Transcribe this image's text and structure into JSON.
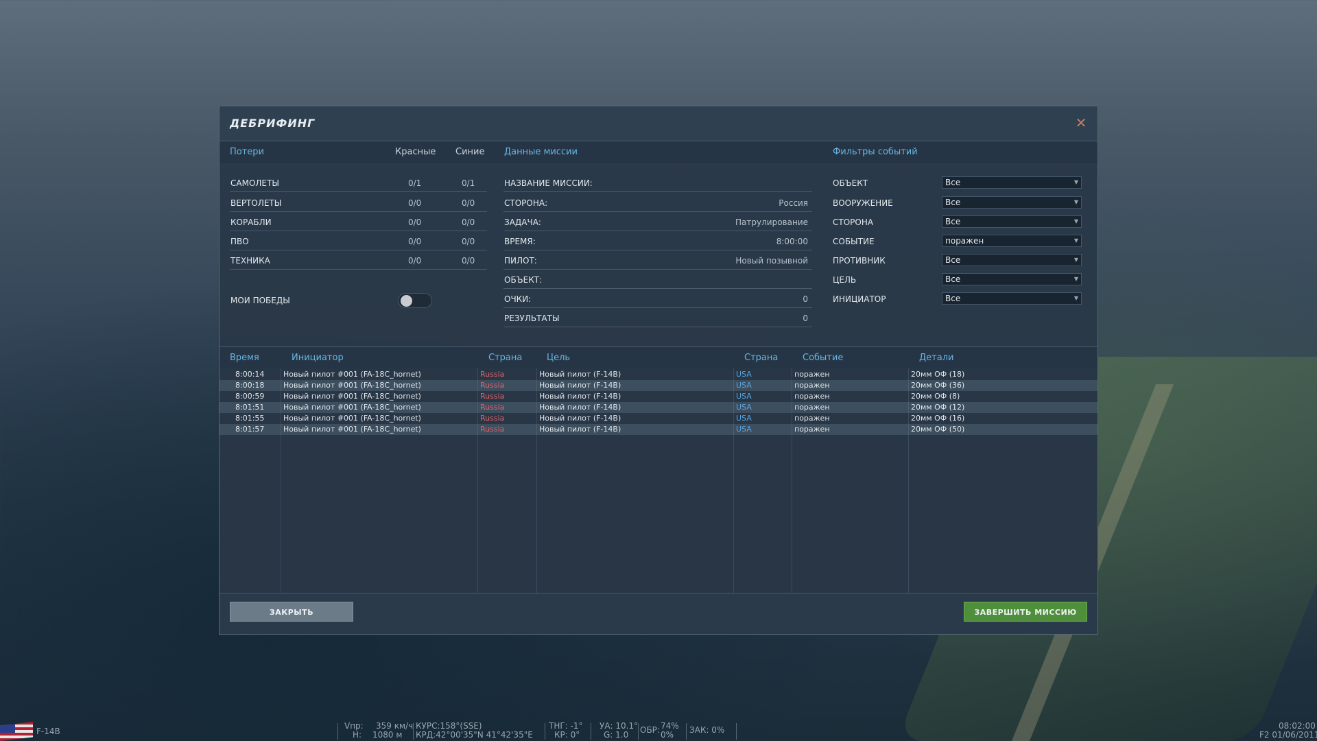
{
  "dialog": {
    "title": "ДЕБРИФИНГ",
    "close_glyph": "✕"
  },
  "losses": {
    "header": "Потери",
    "col_red": "Красные",
    "col_blue": "Синие",
    "rows": [
      {
        "label": "САМОЛЕТЫ",
        "red": "0/1",
        "blue": "0/1"
      },
      {
        "label": "ВЕРТОЛЕТЫ",
        "red": "0/0",
        "blue": "0/0"
      },
      {
        "label": "КОРАБЛИ",
        "red": "0/0",
        "blue": "0/0"
      },
      {
        "label": "ПВО",
        "red": "0/0",
        "blue": "0/0"
      },
      {
        "label": "ТЕХНИКА",
        "red": "0/0",
        "blue": "0/0"
      }
    ],
    "my_wins_label": "МОИ ПОБЕДЫ",
    "my_wins_on": false
  },
  "mission": {
    "header": "Данные миссии",
    "rows": [
      {
        "label": "НАЗВАНИЕ МИССИИ:",
        "value": ""
      },
      {
        "label": "СТОРОНА:",
        "value": "Россия"
      },
      {
        "label": "ЗАДАЧА:",
        "value": "Патрулирование"
      },
      {
        "label": "ВРЕМЯ:",
        "value": "8:00:00"
      },
      {
        "label": "ПИЛОТ:",
        "value": "Новый позывной"
      },
      {
        "label": "ОБЪЕКТ:",
        "value": ""
      },
      {
        "label": "ОЧКИ:",
        "value": "0"
      },
      {
        "label": "РЕЗУЛЬТАТЫ",
        "value": "0"
      }
    ]
  },
  "filters": {
    "header": "Фильтры событий",
    "rows": [
      {
        "label": "ОБЪЕКТ",
        "value": "Все"
      },
      {
        "label": "ВООРУЖЕНИЕ",
        "value": "Все"
      },
      {
        "label": "СТОРОНА",
        "value": "Все"
      },
      {
        "label": "СОБЫТИЕ",
        "value": "поражен"
      },
      {
        "label": "ПРОТИВНИК",
        "value": "Все"
      },
      {
        "label": "ЦЕЛЬ",
        "value": "Все"
      },
      {
        "label": "ИНИЦИАТОР",
        "value": "Все"
      }
    ]
  },
  "log": {
    "columns": [
      "Время",
      "Инициатор",
      "Страна",
      "Цель",
      "Страна",
      "Событие",
      "Детали"
    ],
    "rows": [
      {
        "time": "8:00:14",
        "initiator": "Новый пилот #001 (FA-18C_hornet)",
        "init_country": "Russia",
        "target": "Новый пилот (F-14B)",
        "target_country": "USA",
        "event": "поражен",
        "details": "20мм ОФ (18)"
      },
      {
        "time": "8:00:18",
        "initiator": "Новый пилот #001 (FA-18C_hornet)",
        "init_country": "Russia",
        "target": "Новый пилот (F-14B)",
        "target_country": "USA",
        "event": "поражен",
        "details": "20мм ОФ (36)"
      },
      {
        "time": "8:00:59",
        "initiator": "Новый пилот #001 (FA-18C_hornet)",
        "init_country": "Russia",
        "target": "Новый пилот (F-14B)",
        "target_country": "USA",
        "event": "поражен",
        "details": "20мм ОФ (8)"
      },
      {
        "time": "8:01:51",
        "initiator": "Новый пилот #001 (FA-18C_hornet)",
        "init_country": "Russia",
        "target": "Новый пилот (F-14B)",
        "target_country": "USA",
        "event": "поражен",
        "details": "20мм ОФ (12)"
      },
      {
        "time": "8:01:55",
        "initiator": "Новый пилот #001 (FA-18C_hornet)",
        "init_country": "Russia",
        "target": "Новый пилот (F-14B)",
        "target_country": "USA",
        "event": "поражен",
        "details": "20мм ОФ (16)"
      },
      {
        "time": "8:01:57",
        "initiator": "Новый пилот #001 (FA-18C_hornet)",
        "init_country": "Russia",
        "target": "Новый пилот (F-14B)",
        "target_country": "USA",
        "event": "поражен",
        "details": "20мм ОФ (50)"
      }
    ]
  },
  "buttons": {
    "close": "ЗАКРЫТЬ",
    "finish": "ЗАВЕРШИТЬ МИССИЮ"
  },
  "hud": {
    "aircraft": "F-14B",
    "vpr_label": "Vпр:",
    "vpr_value": "359 км/ч",
    "h_label": "Н:",
    "h_value": "1080 м",
    "kurs": "КУРС:158°(SSE)",
    "krd": "КРД:42°00'35\"N 41°42'35\"E",
    "thrust": "ТНГ: -1°",
    "kr": "КР: 0°",
    "ua": "УА: 10.1°",
    "g": "G: 1.0",
    "obr_label": "ОБР:",
    "obr_value": "74%",
    "obr_value2": "0%",
    "zak": "ЗАК: 0%",
    "time": "08:02:00",
    "date": "F2 01/06/2011"
  },
  "colors": {
    "accent": "#67b6e6",
    "red_side": "#e0636a",
    "blue_side": "#5aa6e2",
    "finish_button": "#4f8f3c",
    "close_x": "#c97e62"
  }
}
